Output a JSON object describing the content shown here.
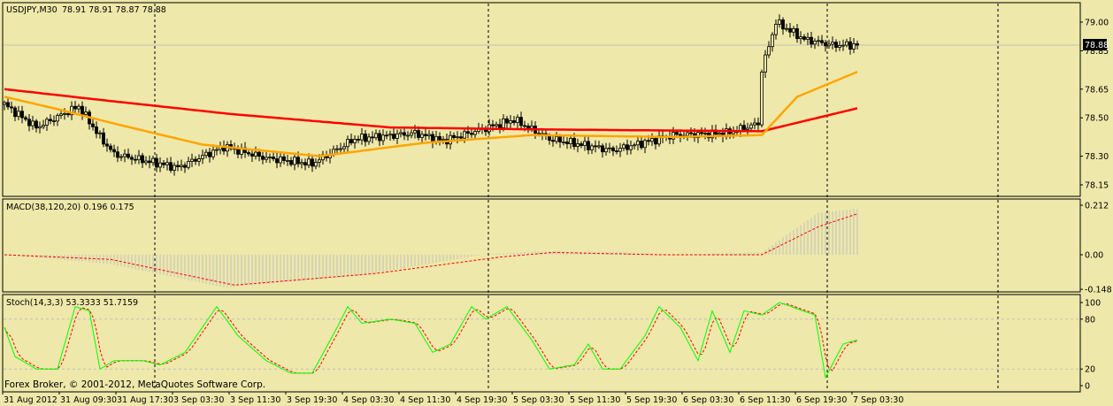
{
  "chart_data": [
    {
      "type": "candlestick",
      "title": "USDJPY,M30",
      "ohlc_label": "78.91 78.91 78.87 78.88",
      "current_price": "78.88",
      "y_ticks": [
        "79.00",
        "78.85",
        "78.65",
        "78.50",
        "78.30",
        "78.15"
      ],
      "ylim": [
        78.1,
        79.1
      ],
      "bars": 242,
      "close_anchors": [
        [
          0,
          78.57
        ],
        [
          9,
          78.45
        ],
        [
          21,
          78.56
        ],
        [
          27,
          78.4
        ],
        [
          31,
          78.31
        ],
        [
          49,
          78.24
        ],
        [
          62,
          78.35
        ],
        [
          74,
          78.29
        ],
        [
          87,
          78.26
        ],
        [
          99,
          78.39
        ],
        [
          116,
          78.42
        ],
        [
          124,
          78.38
        ],
        [
          144,
          78.49
        ],
        [
          154,
          78.39
        ],
        [
          172,
          78.33
        ],
        [
          189,
          78.41
        ],
        [
          204,
          78.42
        ],
        [
          213,
          78.47
        ],
        [
          214,
          78.75
        ],
        [
          218,
          79.0
        ],
        [
          226,
          78.91
        ],
        [
          234,
          78.88
        ],
        [
          241,
          78.88
        ]
      ],
      "series": [
        {
          "name": "MA slow",
          "color": "#FF0000",
          "anchors": [
            [
              0,
              78.65
            ],
            [
              29,
              78.59
            ],
            [
              64,
              78.52
            ],
            [
              109,
              78.45
            ],
            [
              149,
              78.44
            ],
            [
              214,
              78.43
            ],
            [
              241,
              78.55
            ]
          ]
        },
        {
          "name": "MA fast",
          "color": "#FFA500",
          "anchors": [
            [
              0,
              78.61
            ],
            [
              14,
              78.55
            ],
            [
              31,
              78.47
            ],
            [
              56,
              78.36
            ],
            [
              89,
              78.3
            ],
            [
              119,
              78.37
            ],
            [
              149,
              78.41
            ],
            [
              189,
              78.4
            ],
            [
              214,
              78.41
            ],
            [
              224,
              78.61
            ],
            [
              241,
              78.74
            ]
          ]
        }
      ]
    },
    {
      "type": "bar+line",
      "title": "MACD(38,120,20) 0.196 0.175",
      "y_ticks": [
        "0.212",
        "0.00",
        "-0.148"
      ],
      "ylim": [
        -0.148,
        0.212
      ],
      "macd_anchors": [
        [
          0,
          0.0
        ],
        [
          30,
          -0.04
        ],
        [
          62,
          -0.14
        ],
        [
          100,
          -0.09
        ],
        [
          135,
          0.0
        ],
        [
          150,
          0.015
        ],
        [
          175,
          0.012
        ],
        [
          190,
          0.0
        ],
        [
          214,
          0.01
        ],
        [
          230,
          0.18
        ],
        [
          241,
          0.196
        ]
      ],
      "signal_anchors": [
        [
          0,
          0.0
        ],
        [
          30,
          -0.02
        ],
        [
          65,
          -0.13
        ],
        [
          105,
          -0.08
        ],
        [
          140,
          -0.01
        ],
        [
          155,
          0.01
        ],
        [
          185,
          0.0
        ],
        [
          214,
          0.0
        ],
        [
          230,
          0.12
        ],
        [
          241,
          0.175
        ]
      ]
    },
    {
      "type": "line",
      "title": "Stoch(14,3,3) 53.3333 51.7159",
      "y_ticks": [
        "100",
        "80",
        "20",
        "0"
      ],
      "ylim": [
        0,
        100
      ],
      "levels": [
        80,
        20
      ],
      "k_anchors": [
        [
          0,
          70
        ],
        [
          3,
          35
        ],
        [
          9,
          20
        ],
        [
          15,
          20
        ],
        [
          20,
          95
        ],
        [
          24,
          90
        ],
        [
          27,
          20
        ],
        [
          31,
          30
        ],
        [
          39,
          30
        ],
        [
          44,
          25
        ],
        [
          51,
          40
        ],
        [
          60,
          95
        ],
        [
          66,
          60
        ],
        [
          74,
          30
        ],
        [
          81,
          15
        ],
        [
          87,
          15
        ],
        [
          94,
          70
        ],
        [
          97,
          95
        ],
        [
          101,
          75
        ],
        [
          109,
          80
        ],
        [
          116,
          75
        ],
        [
          121,
          40
        ],
        [
          126,
          50
        ],
        [
          132,
          95
        ],
        [
          136,
          80
        ],
        [
          142,
          95
        ],
        [
          149,
          55
        ],
        [
          154,
          20
        ],
        [
          161,
          25
        ],
        [
          165,
          50
        ],
        [
          169,
          20
        ],
        [
          174,
          20
        ],
        [
          181,
          60
        ],
        [
          185,
          95
        ],
        [
          191,
          70
        ],
        [
          196,
          30
        ],
        [
          200,
          90
        ],
        [
          205,
          40
        ],
        [
          209,
          90
        ],
        [
          214,
          85
        ],
        [
          219,
          100
        ],
        [
          229,
          85
        ],
        [
          232,
          10
        ],
        [
          237,
          50
        ],
        [
          241,
          55
        ]
      ]
    }
  ],
  "time_labels": [
    "31 Aug 2012",
    "31 Aug 09:30",
    "31 Aug 17:30",
    "3 Sep 03:30",
    "3 Sep 11:30",
    "3 Sep 19:30",
    "4 Sep 03:30",
    "4 Sep 11:30",
    "4 Sep 19:30",
    "5 Sep 03:30",
    "5 Sep 11:30",
    "5 Sep 19:30",
    "6 Sep 03:30",
    "6 Sep 11:30",
    "6 Sep 19:30",
    "7 Sep 03:30"
  ],
  "copyright": "Forex Broker, © 2001-2012, MetaQuotes Software Corp.",
  "colors": {
    "background": "#EEE8AA",
    "up": "#EEE8AA",
    "down": "#000000",
    "ma_slow": "#FF0000",
    "ma_fast": "#FFA500",
    "stoch_k": "#00FF00",
    "signal": "#FF0000",
    "histogram": "#C0C0C0"
  }
}
